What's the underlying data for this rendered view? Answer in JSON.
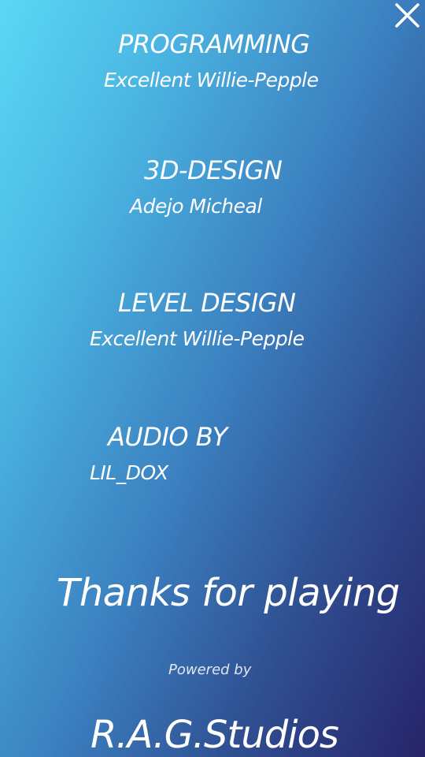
{
  "credits": [
    {
      "role": "PROGRAMMING",
      "name": "Excellent Willie-Pepple"
    },
    {
      "role": "3D-DESIGN",
      "name": "Adejo Micheal"
    },
    {
      "role": "LEVEL DESIGN",
      "name": "Excellent Willie-Pepple"
    },
    {
      "role": "AUDIO BY",
      "name": "LIL_DOX"
    }
  ],
  "thanks_text": "Thanks for playing",
  "powered_by": "Powered by",
  "studio_name": "R.A.G.Studios",
  "icons": {
    "close": "close-icon"
  },
  "colors": {
    "gradient_light": "#5ad8f4",
    "gradient_mid": "#3b7fbf",
    "gradient_dark": "#27246a",
    "text": "#ffffff"
  }
}
